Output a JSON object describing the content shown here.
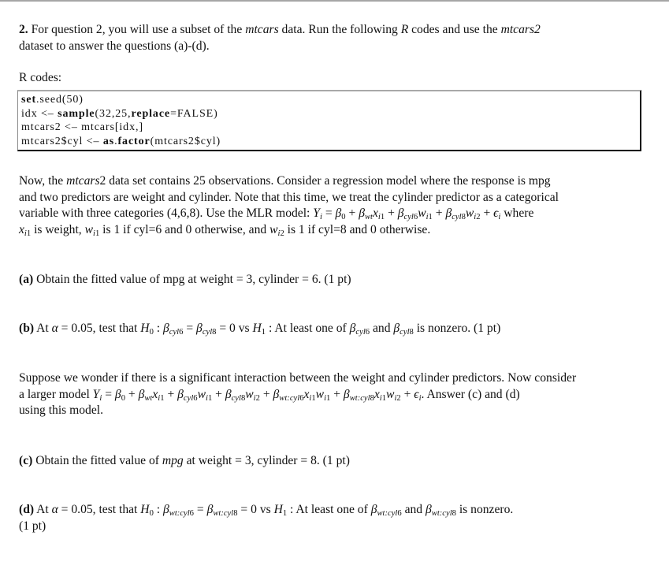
{
  "question": {
    "number": "2.",
    "intro_parts": [
      "For question 2, you will use a subset of the ",
      "mtcars",
      " data. Run the following ",
      "R",
      " codes and use the ",
      "mtcars2"
    ],
    "intro_line2": "dataset to answer the questions (a)-(d)."
  },
  "code_section": {
    "label": "R codes:",
    "lines": [
      {
        "kw": "set",
        "rest": ".seed(50)"
      },
      {
        "pre": "idx <– ",
        "kw": "sample",
        "mid": "(32,25,",
        "kw2": "replace",
        "rest": "=FALSE)"
      },
      {
        "pre": "mtcars2 <– mtcars[idx,]"
      },
      {
        "pre": "mtcars2$cyl <– ",
        "kw": "as",
        "mid": ".",
        "kw2": "factor",
        "rest": "(mtcars2$cyl)"
      }
    ]
  },
  "model_paragraph": {
    "line1_a": "Now, the ",
    "line1_it": "mtcars",
    "line1_b": "2 data set contains 25 observations.  Consider a regression model where the response is mpg",
    "line2": "and two predictors are weight and cylinder.  Note that this time, we treat the cylinder predictor as a categorical",
    "line3_a": "variable with three categories (4,6,8).  Use the MLR model: ",
    "line3_b": " where",
    "line4_a": " is weight, ",
    "line4_b": " is 1 if cyl=6 and 0 otherwise, and ",
    "line4_c": " is 1 if cyl=8 and 0 otherwise."
  },
  "parts": {
    "a": {
      "label": "(a)",
      "text": " Obtain the fitted value of mpg at weight = 3, cylinder = 6.  (1 pt)"
    },
    "b": {
      "label": "(b)",
      "t1": " At ",
      "t2": " = 0.05, test that ",
      "t3": " = 0 vs ",
      "t4": " : At least one of ",
      "t5": " and ",
      "t6": " is nonzero.  (1 pt)"
    },
    "c": {
      "label": "(c)",
      "t1": " Obtain the fitted value of ",
      "t2": "mpg",
      "t3": " at weight = 3, cylinder = 8.  (1 pt)"
    },
    "d": {
      "label": "(d)",
      "t1": " At ",
      "t2": " = 0.05, test that ",
      "t3": " = 0 vs ",
      "t4": " : At least one of ",
      "t5": " and ",
      "t6": " is nonzero.",
      "line2": "(1 pt)"
    }
  },
  "interaction_paragraph": {
    "line1": "Suppose we wonder if there is a significant interaction between the weight and cylinder predictors.  Now consider",
    "line2_a": "a larger model ",
    "line2_b": ".  Answer (c) and (d)",
    "line3": "using this model."
  }
}
